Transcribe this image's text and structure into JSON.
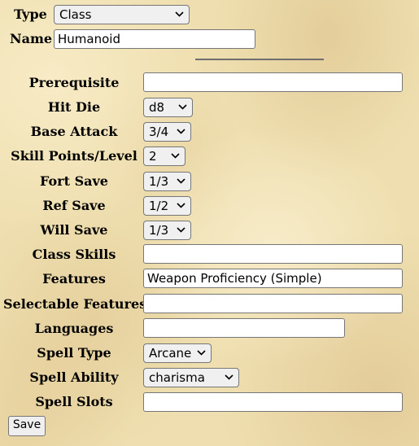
{
  "header": {
    "type_label": "Type",
    "type_value": "Class",
    "name_label": "Name",
    "name_value": "Humanoid"
  },
  "fields": {
    "prerequisite": {
      "label": "Prerequisite",
      "value": ""
    },
    "hit_die": {
      "label": "Hit Die",
      "value": "d8"
    },
    "base_attack": {
      "label": "Base Attack",
      "value": "3/4"
    },
    "skill_points": {
      "label": "Skill Points/Level",
      "value": "2"
    },
    "fort_save": {
      "label": "Fort Save",
      "value": "1/3"
    },
    "ref_save": {
      "label": "Ref Save",
      "value": "1/2"
    },
    "will_save": {
      "label": "Will Save",
      "value": "1/3"
    },
    "class_skills": {
      "label": "Class Skills",
      "value": ""
    },
    "features": {
      "label": "Features",
      "value": "Weapon Proficiency (Simple)"
    },
    "selectable_features": {
      "label": "Selectable Features",
      "value": ""
    },
    "languages": {
      "label": "Languages",
      "value": ""
    },
    "spell_type": {
      "label": "Spell Type",
      "value": "Arcane"
    },
    "spell_ability": {
      "label": "Spell Ability",
      "value": "charisma"
    },
    "spell_slots": {
      "label": "Spell Slots",
      "value": ""
    }
  },
  "actions": {
    "save_label": "Save"
  },
  "icons": {
    "dropdown": "chevron-down-icon"
  },
  "colors": {
    "parchment": "#efdfb0",
    "border": "#767676"
  }
}
